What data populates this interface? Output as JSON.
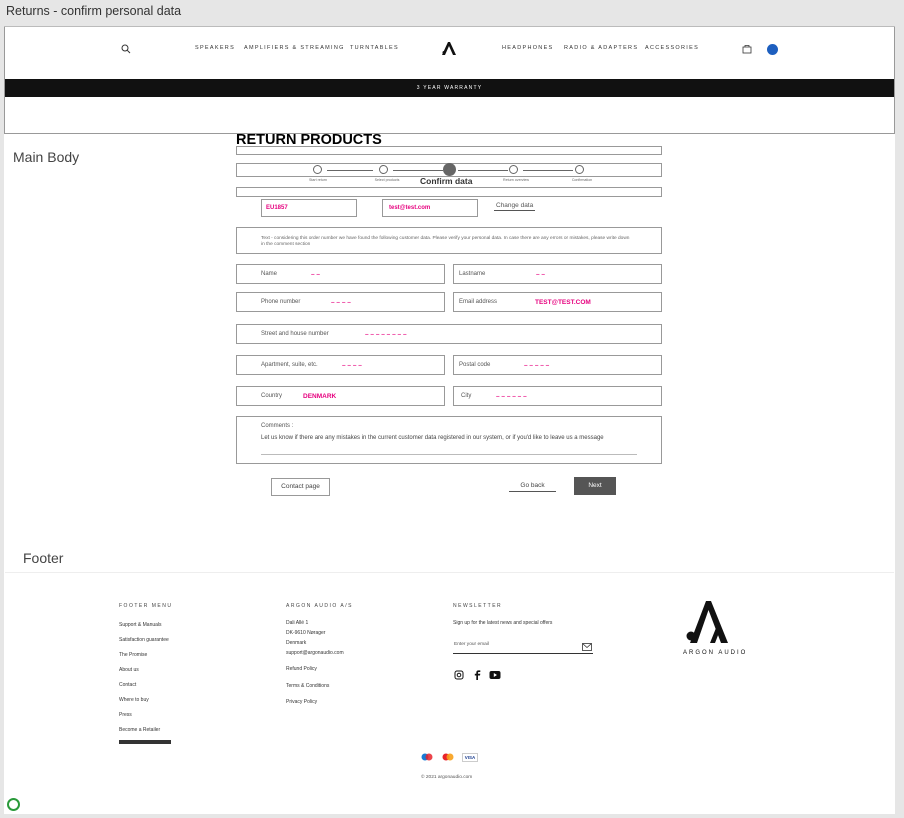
{
  "window": {
    "title": "Returns - confirm personal data"
  },
  "header": {
    "nav_left": [
      "SPEAKERS",
      "AMPLIFIERS & STREAMING",
      "TURNTABLES"
    ],
    "nav_right": [
      "HEADPHONES",
      "RADIO & ADAPTERS",
      "ACCESSORIES"
    ],
    "icons": {
      "search": "search-icon",
      "logo": "argon-logo-icon",
      "cart": "cart-icon",
      "region": "globe-icon"
    },
    "warranty": "3 YEAR WARRANTY"
  },
  "labels": {
    "main_body": "Main Body",
    "footer": "Footer"
  },
  "form": {
    "title": "RETURN PRODUCTS",
    "steps": [
      "Start return",
      "Select products",
      "Confirm data",
      "Return overview",
      "Confirmation"
    ],
    "current_step_label": "Confirm data",
    "order_number": "EU1857",
    "order_email": "test@test.com",
    "change_data": "Change data",
    "info_text": "Text - considering this order number we have found the following customer data. Please verify your personal data. In case there are any errors or mistakes, please write down in the comment section",
    "fields": {
      "name": {
        "label": "Name",
        "value": "– –"
      },
      "lastname": {
        "label": "Lastname",
        "value": "– –"
      },
      "phone": {
        "label": "Phone number",
        "value": "– – – –"
      },
      "email": {
        "label": "Email address",
        "value": "TEST@TEST.COM"
      },
      "street": {
        "label": "Street and house number",
        "value": "– – – – – – – –"
      },
      "apartment": {
        "label": "Apartment, suite, etc.",
        "value": "– – – –"
      },
      "postal": {
        "label": "Postal code",
        "value": "– – – – –"
      },
      "country": {
        "label": "Country",
        "value": "DENMARK"
      },
      "city": {
        "label": "City",
        "value": "– – – – – –"
      }
    },
    "comments_label": "Comments :",
    "comments_placeholder": "Let us know if there are any mistakes in the current customer data registered in our system, or if you'd like to leave us a message",
    "buttons": {
      "contact": "Contact page",
      "back": "Go back",
      "next": "Next"
    }
  },
  "footer": {
    "menu_heading": "FOOTER MENU",
    "menu_items": [
      "Support & Manuals",
      "Satisfaction guarantee",
      "The Promise",
      "About us",
      "Contact",
      "Where to buy",
      "Press",
      "Become a Retailer"
    ],
    "company_heading": "ARGON AUDIO A/S",
    "address": [
      "Dali Allé 1",
      "DK-9610 Nørager",
      "Denmark",
      "support@argonaudio.com"
    ],
    "company_links": [
      "Refund Policy",
      "Terms & Conditions",
      "Privacy Policy"
    ],
    "newsletter_heading": "NEWSLETTER",
    "newsletter_text": "Sign up for the latest news and special offers",
    "email_placeholder": "Enter your email",
    "social_icons": [
      "instagram-icon",
      "facebook-icon",
      "youtube-icon"
    ],
    "brand": "ARGON AUDIO",
    "payments": [
      "maestro-icon",
      "mastercard-icon",
      "VISA"
    ],
    "copyright": "© 2021 argonaudio.com"
  }
}
